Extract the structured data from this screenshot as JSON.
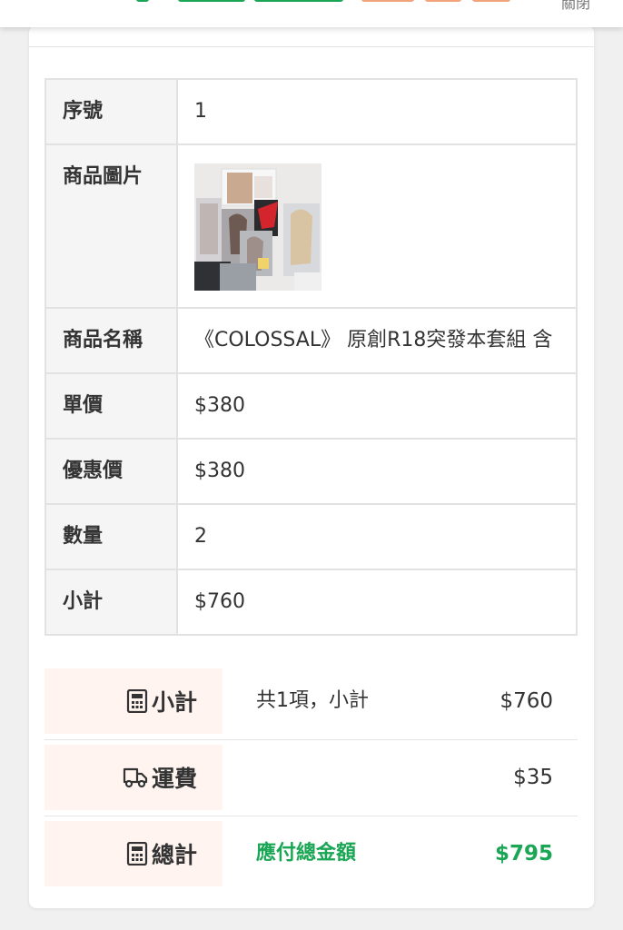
{
  "header": {
    "close_label": "關閉"
  },
  "order_item": {
    "rows": {
      "index": {
        "label": "序號",
        "value": "1"
      },
      "image": {
        "label": "商品圖片",
        "alt": "COLOSSAL 原創R18突發本套組 商品照片"
      },
      "name": {
        "label": "商品名稱",
        "value": "《COLOSSAL》 原創R18突發本套組 含"
      },
      "unit_price": {
        "label": "單價",
        "value": "$380"
      },
      "sale_price": {
        "label": "優惠價",
        "value": "$380"
      },
      "quantity": {
        "label": "數量",
        "value": "2"
      },
      "subtotal": {
        "label": "小計",
        "value": "$760"
      }
    }
  },
  "summary": {
    "subtotal": {
      "icon": "calculator-icon",
      "label": "小計",
      "desc": "共1項，小計",
      "amount": "$760"
    },
    "shipping": {
      "icon": "truck-icon",
      "label": "運費",
      "desc": "",
      "amount": "$35"
    },
    "total": {
      "icon": "calculator-icon",
      "label": "總計",
      "desc": "應付總金額",
      "amount": "$795"
    }
  },
  "colors": {
    "accent_green": "#1aa654",
    "label_bg": "#fff4f0",
    "table_label_bg": "#f5f5f5"
  }
}
